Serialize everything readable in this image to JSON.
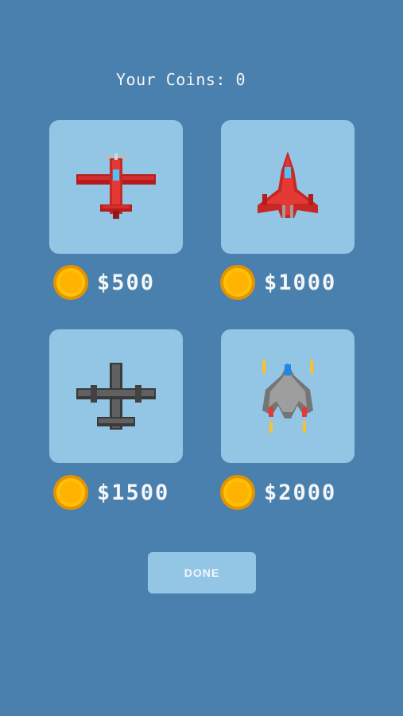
{
  "header": {
    "coins_text": "Your Coins: 0"
  },
  "shop": {
    "items": [
      {
        "name": "red-propeller-plane",
        "price": "$500"
      },
      {
        "name": "red-jet-fighter",
        "price": "$1000"
      },
      {
        "name": "gray-cargo-plane",
        "price": "$1500"
      },
      {
        "name": "gray-starfighter",
        "price": "$2000"
      }
    ]
  },
  "buttons": {
    "done_label": "DONE"
  },
  "colors": {
    "background": "#4a80ad",
    "card": "#93c6e5",
    "coin": "#f7b500",
    "text": "#f4f6f8"
  },
  "icons": [
    "coin-icon",
    "red-propeller-plane-icon",
    "red-jet-fighter-icon",
    "gray-cargo-plane-icon",
    "gray-starfighter-icon"
  ]
}
